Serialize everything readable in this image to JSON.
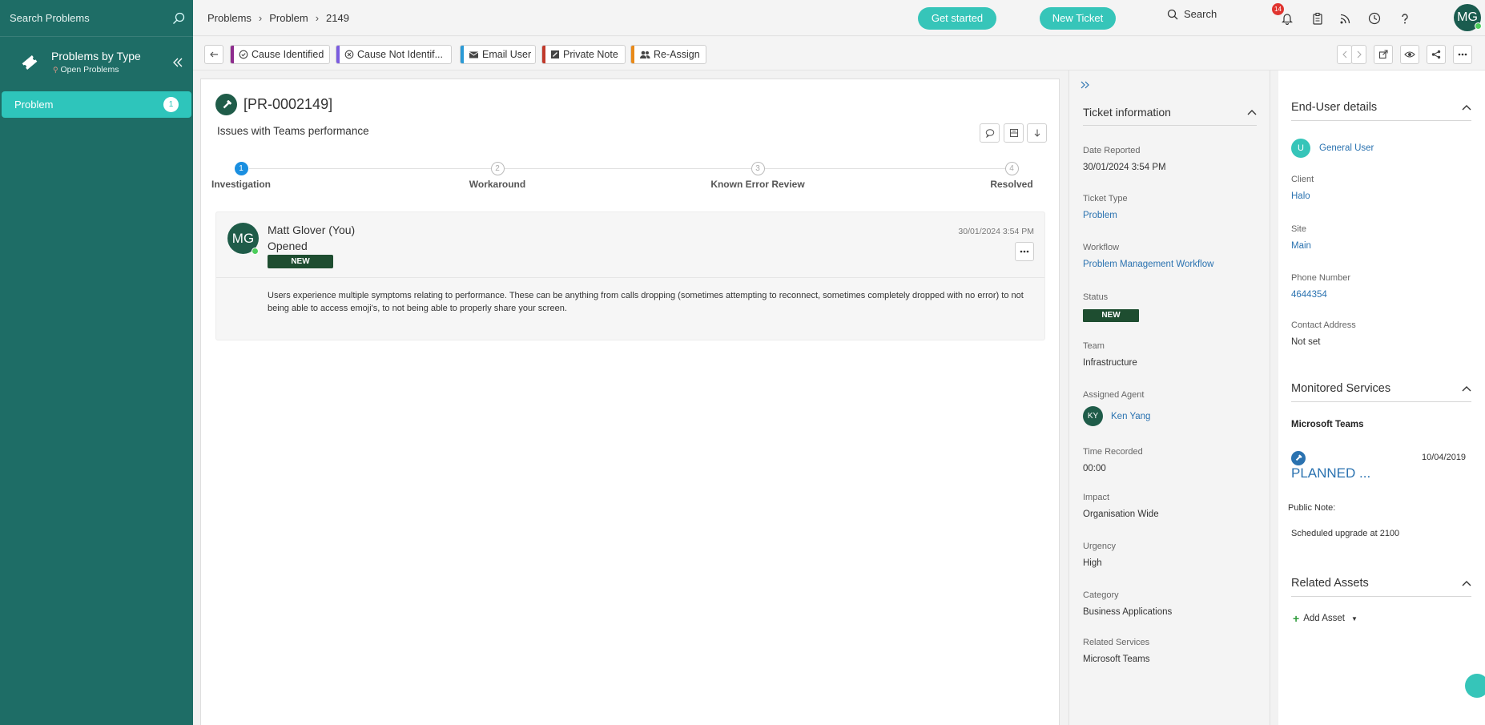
{
  "sidebar": {
    "search_placeholder": "Search Problems",
    "title": "Problems by Type",
    "subtitle": "Open Problems",
    "items": [
      {
        "label": "Problem",
        "count": "1"
      }
    ]
  },
  "breadcrumb": [
    "Problems",
    "Problem",
    "2149"
  ],
  "topbar": {
    "get_started": "Get started",
    "new_ticket": "New Ticket",
    "search": "Search",
    "notification_count": "14",
    "user_initials": "MG"
  },
  "actions": [
    {
      "label": "Cause Identified",
      "color": "#8e2c8e"
    },
    {
      "label": "Cause Not Identif...",
      "color": "#7b5ce0"
    },
    {
      "label": "Email User",
      "color": "#2a9ad6"
    },
    {
      "label": "Private Note",
      "color": "#c0392b"
    },
    {
      "label": "Re-Assign",
      "color": "#e88a1a"
    }
  ],
  "ticket": {
    "id": "[PR-0002149]",
    "summary": "Issues with Teams performance",
    "steps": [
      {
        "num": "1",
        "label": "Investigation"
      },
      {
        "num": "2",
        "label": "Workaround"
      },
      {
        "num": "3",
        "label": "Known Error Review"
      },
      {
        "num": "4",
        "label": "Resolved"
      }
    ],
    "active_step": 1
  },
  "feed": {
    "initials": "MG",
    "author": "Matt Glover (You)",
    "action": "Opened",
    "status": "NEW",
    "date": "30/01/2024 3:54 PM",
    "body": "Users experience multiple symptoms relating to performance. These can be anything from calls dropping (sometimes attempting to reconnect, sometimes completely dropped with no error) to not being able to access emoji's, to not being able to properly share your screen."
  },
  "ticket_info": {
    "title": "Ticket information",
    "date_reported_label": "Date Reported",
    "date_reported": "30/01/2024 3:54 PM",
    "ticket_type_label": "Ticket Type",
    "ticket_type": "Problem",
    "workflow_label": "Workflow",
    "workflow": "Problem Management Workflow",
    "status_label": "Status",
    "status": "NEW",
    "team_label": "Team",
    "team": "Infrastructure",
    "agent_label": "Assigned Agent",
    "agent_initials": "KY",
    "agent": "Ken Yang",
    "time_label": "Time Recorded",
    "time": "00:00",
    "impact_label": "Impact",
    "impact": "Organisation Wide",
    "urgency_label": "Urgency",
    "urgency": "High",
    "category_label": "Category",
    "category": "Business Applications",
    "related_services_label": "Related Services",
    "related_services": "Microsoft Teams"
  },
  "end_user": {
    "title": "End-User details",
    "user_initial": "U",
    "user": "General User",
    "client_label": "Client",
    "client": "Halo",
    "site_label": "Site",
    "site": "Main",
    "phone_label": "Phone Number",
    "phone": "4644354",
    "contact_label": "Contact Address",
    "contact": "Not set"
  },
  "monitored": {
    "title": "Monitored Services",
    "service": "Microsoft Teams",
    "date": "10/04/2019",
    "state": "PLANNED ...",
    "note_label": "Public Note:",
    "note": "Scheduled upgrade at 2100"
  },
  "related_assets": {
    "title": "Related Assets",
    "add_label": "Add Asset"
  }
}
